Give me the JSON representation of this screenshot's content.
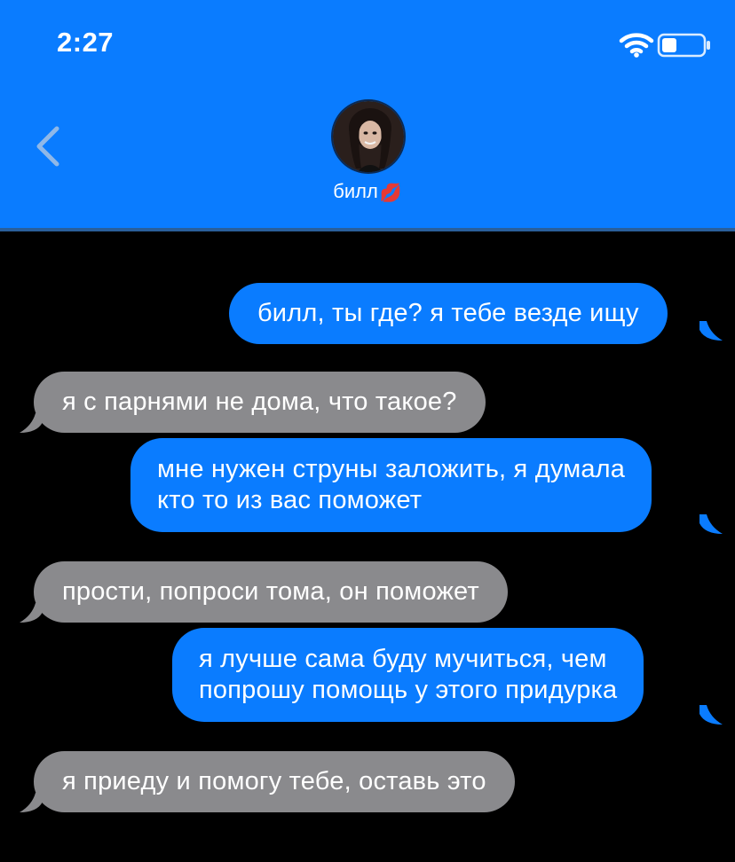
{
  "status_bar": {
    "time": "2:27"
  },
  "header": {
    "contact_name": "билл",
    "name_emoji": "💋"
  },
  "messages": [
    {
      "direction": "outgoing",
      "text": "билл, ты где? я тебе везде ищу"
    },
    {
      "direction": "incoming",
      "text": "я с парнями не дома, что такое?"
    },
    {
      "direction": "outgoing",
      "lines": [
        "мне нужен струны заложить, я думала",
        "кто то из вас поможет"
      ]
    },
    {
      "direction": "incoming",
      "text": "прости, попроси тома, он поможет"
    },
    {
      "direction": "outgoing",
      "lines": [
        "я лучше сама буду мучиться, чем",
        "попрошу помощь у этого придурка"
      ]
    },
    {
      "direction": "incoming",
      "text": "я приеду и помогу тебе, оставь это"
    }
  ],
  "colors": {
    "header": "#0A7CFF",
    "outgoing_bubble": "#0A7CFF",
    "incoming_bubble": "#8a8a8d",
    "background": "#000000"
  },
  "icons": [
    "wifi-icon",
    "battery-icon",
    "chevron-left-icon",
    "avatar"
  ]
}
